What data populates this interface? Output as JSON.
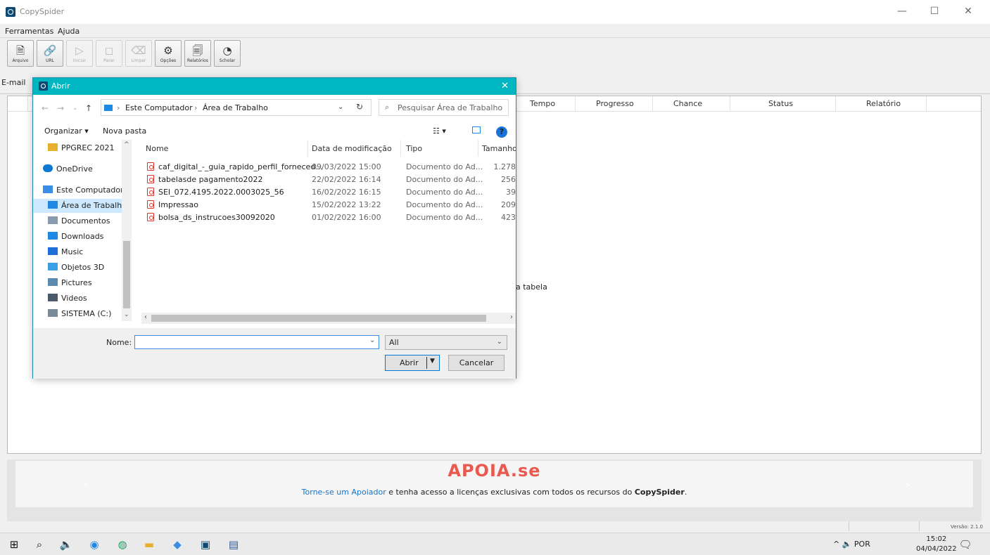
{
  "window": {
    "title": "CopySpider",
    "minimize": "—",
    "maximize": "☐",
    "close": "✕"
  },
  "menu": [
    "Ferramentas",
    "Ajuda"
  ],
  "toolbar": {
    "buttons": [
      {
        "label": "Arquivo",
        "icon": "file-add-icon",
        "glyph": "🗎",
        "enabled": true
      },
      {
        "label": "URL",
        "icon": "link-icon",
        "glyph": "🔗",
        "enabled": true
      },
      {
        "label": "Iniciar",
        "icon": "play-icon",
        "glyph": "▷",
        "enabled": false
      },
      {
        "label": "Parar",
        "icon": "stop-icon",
        "glyph": "◻",
        "enabled": false
      },
      {
        "label": "Limpar",
        "icon": "broom-icon",
        "glyph": "⌫",
        "enabled": false
      },
      {
        "label": "Opções",
        "icon": "gear-icon",
        "glyph": "⚙",
        "enabled": true
      },
      {
        "label": "Relatórios",
        "icon": "report-icon",
        "glyph": "🗐",
        "enabled": true
      },
      {
        "label": "Scholar",
        "icon": "pie-chart-icon",
        "glyph": "◔",
        "enabled": true
      }
    ]
  },
  "main": {
    "email_label": "E-mail",
    "columns": [
      "Tempo",
      "Progresso",
      "Chance",
      "Status",
      "Relatório"
    ],
    "empty_text": "a tabela"
  },
  "banner": {
    "logo": "APOIA.se",
    "link_text": "Torne-se um Apoiador",
    "text_mid": " e tenha acesso a licenças exclusivas com todos os recursos do ",
    "brand": "CopySpider",
    "text_end": ".",
    "prev": "‹",
    "next": "›"
  },
  "status": {
    "version": "Versão: 2.1.0"
  },
  "taskbar": {
    "tray_text": "^  🔈  POR",
    "time": "15:02",
    "date": "04/04/2022"
  },
  "dialog": {
    "title": "Abrir",
    "close": "✕",
    "breadcrumb": [
      "Este Computador",
      "Área de Trabalho"
    ],
    "search_placeholder": "Pesquisar Área de Trabalho",
    "organize": "Organizar ▾",
    "new_folder": "Nova pasta",
    "help": "?",
    "nav_items": [
      {
        "label": "PPGREC 2021",
        "icon": "folder-icon",
        "color": "#e8b12d",
        "selected": false
      },
      {
        "label": "OneDrive",
        "icon": "cloud-icon",
        "color": "#0f78d4",
        "selected": false
      },
      {
        "label": "Este Computador",
        "icon": "computer-icon",
        "color": "#3a8ee6",
        "selected": false
      },
      {
        "label": "Área de Trabalho",
        "icon": "desktop-icon",
        "color": "#1e88e5",
        "selected": true
      },
      {
        "label": "Documentos",
        "icon": "documents-icon",
        "color": "#8a9bb0",
        "selected": false
      },
      {
        "label": "Downloads",
        "icon": "download-icon",
        "color": "#1e88e5",
        "selected": false
      },
      {
        "label": "Music",
        "icon": "music-icon",
        "color": "#1e6fd9",
        "selected": false
      },
      {
        "label": "Objetos 3D",
        "icon": "cube-icon",
        "color": "#3aa0e6",
        "selected": false
      },
      {
        "label": "Pictures",
        "icon": "pictures-icon",
        "color": "#5b8bb0",
        "selected": false
      },
      {
        "label": "Videos",
        "icon": "video-icon",
        "color": "#4a5a6a",
        "selected": false
      },
      {
        "label": "SISTEMA (C:)",
        "icon": "drive-icon",
        "color": "#7a8a99",
        "selected": false
      }
    ],
    "file_columns": {
      "name": "Nome",
      "date": "Data de modificação",
      "type": "Tipo",
      "size": "Tamanho"
    },
    "files": [
      {
        "name": "caf_digital_-_guia_rapido_perfil_forneced...",
        "date": "09/03/2022 15:00",
        "type": "Documento do Ad...",
        "size": "1.278"
      },
      {
        "name": "tabelasde pagamento2022",
        "date": "22/02/2022 16:14",
        "type": "Documento do Ad...",
        "size": "256"
      },
      {
        "name": "SEI_072.4195.2022.0003025_56",
        "date": "16/02/2022 16:15",
        "type": "Documento do Ad...",
        "size": "39"
      },
      {
        "name": "Impressao",
        "date": "15/02/2022 13:22",
        "type": "Documento do Ad...",
        "size": "209"
      },
      {
        "name": "bolsa_ds_instrucoes30092020",
        "date": "01/02/2022 16:00",
        "type": "Documento do Ad...",
        "size": "423"
      }
    ],
    "name_label": "Nome:",
    "name_value": "",
    "filter_value": "All",
    "open_label": "Abrir",
    "cancel_label": "Cancelar"
  }
}
